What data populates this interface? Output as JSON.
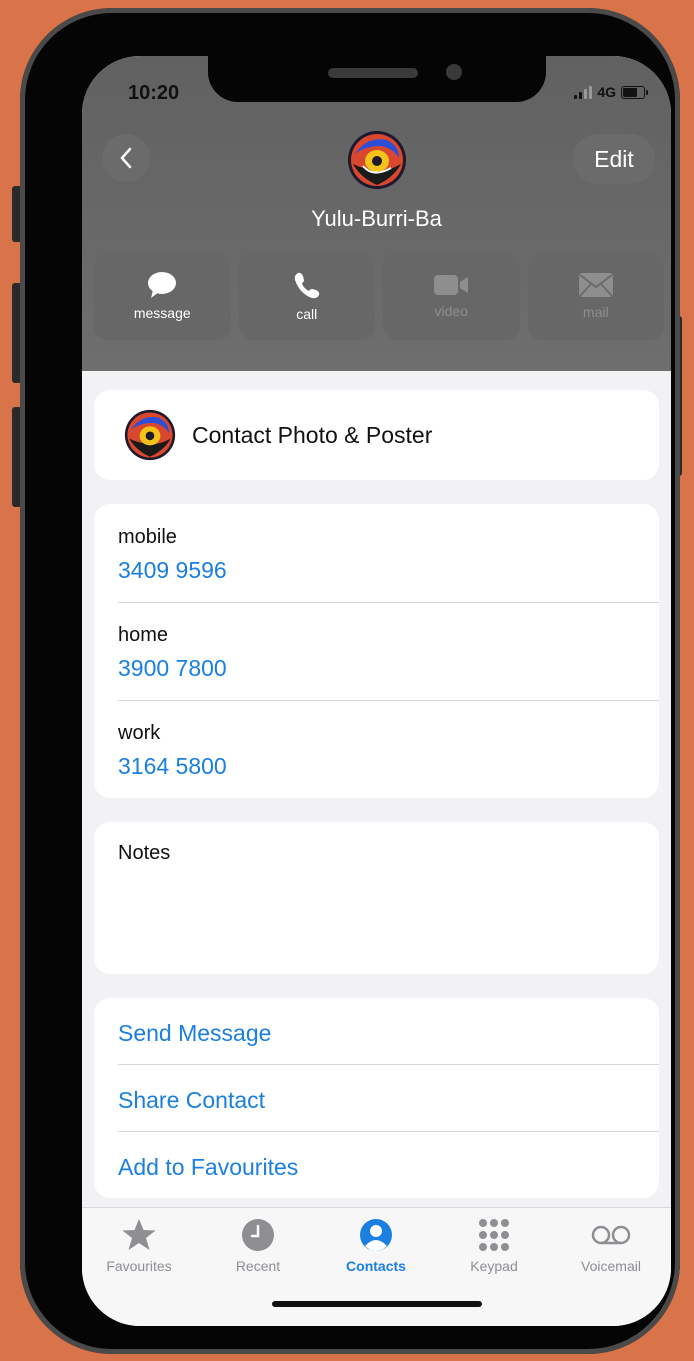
{
  "status": {
    "time": "10:20",
    "network": "4G"
  },
  "header": {
    "back_icon": "chevron-left-icon",
    "edit_label": "Edit",
    "contact_name": "Yulu-Burri-Ba"
  },
  "actions": [
    {
      "label": "message",
      "icon": "message-bubble-icon",
      "enabled": true
    },
    {
      "label": "call",
      "icon": "phone-icon",
      "enabled": true
    },
    {
      "label": "video",
      "icon": "video-camera-icon",
      "enabled": false
    },
    {
      "label": "mail",
      "icon": "envelope-icon",
      "enabled": false
    }
  ],
  "photo_card": {
    "label": "Contact Photo & Poster"
  },
  "phones": [
    {
      "type": "mobile",
      "number": "3409 9596"
    },
    {
      "type": "home",
      "number": "3900 7800"
    },
    {
      "type": "work",
      "number": "3164 5800"
    }
  ],
  "notes": {
    "label": "Notes"
  },
  "links": {
    "send_message": "Send Message",
    "share_contact": "Share Contact",
    "add_favourites": "Add to Favourites"
  },
  "tabs": [
    {
      "label": "Favourites",
      "icon": "star-icon",
      "active": false
    },
    {
      "label": "Recent",
      "icon": "clock-icon",
      "active": false
    },
    {
      "label": "Contacts",
      "icon": "person-circle-icon",
      "active": true
    },
    {
      "label": "Keypad",
      "icon": "keypad-icon",
      "active": false
    },
    {
      "label": "Voicemail",
      "icon": "voicemail-icon",
      "active": false
    }
  ],
  "colors": {
    "accent": "#1a7fe0",
    "background": "#d8734a",
    "header": "#666666"
  }
}
